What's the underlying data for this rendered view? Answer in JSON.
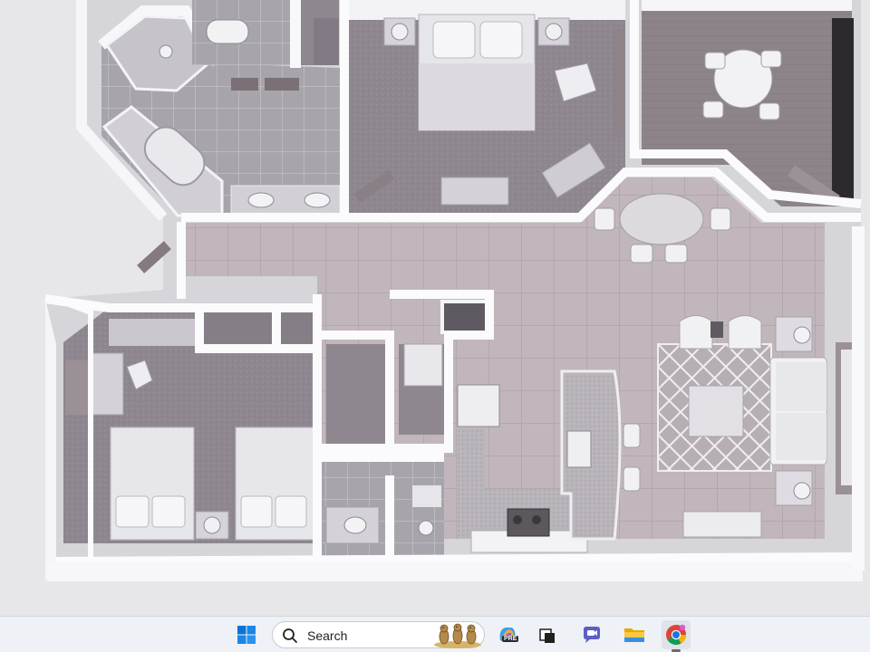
{
  "viewer": {
    "content": "floor-plan-render"
  },
  "taskbar": {
    "search": {
      "label": "Search"
    },
    "search_badge": "meerkats-illustration",
    "items": [
      {
        "name": "start-button",
        "icon": "windows-logo-icon"
      },
      {
        "name": "copilot-button",
        "icon": "copilot-icon",
        "badge": "PRE"
      },
      {
        "name": "task-view-button",
        "icon": "task-view-icon"
      },
      {
        "name": "chat-button",
        "icon": "chat-icon"
      },
      {
        "name": "file-explorer-button",
        "icon": "folder-icon"
      },
      {
        "name": "chrome-button",
        "icon": "chrome-icon",
        "active": true
      }
    ]
  },
  "colors": {
    "wall": "#fbfbfd",
    "carpet": "#8f8790",
    "tile": "#bdb4b9",
    "accent_blue": "#1a73e8"
  }
}
